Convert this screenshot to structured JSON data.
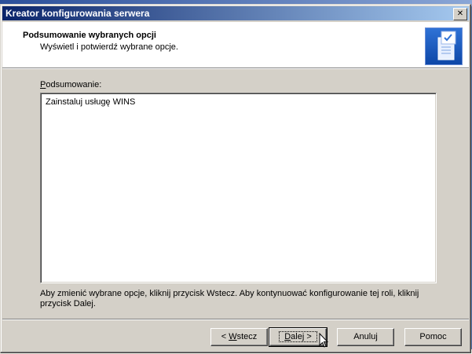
{
  "window": {
    "title": "Kreator konfigurowania serwera",
    "close_glyph": "✕"
  },
  "header": {
    "title": "Podsumowanie wybranych opcji",
    "subtitle": "Wyświetl i potwierdź wybrane opcje.",
    "icon": "server-wizard-icon"
  },
  "summary": {
    "label_accesskey": "P",
    "label_rest": "odsumowanie:",
    "text": "Zainstaluj usługę WINS"
  },
  "instruction": "Aby zmienić wybrane opcje, kliknij przycisk Wstecz. Aby kontynuować konfigurowanie tej roli, kliknij przycisk Dalej.",
  "buttons": {
    "back_prefix": "< ",
    "back_accesskey": "W",
    "back_rest": "stecz",
    "next_accesskey": "D",
    "next_rest": "alej >",
    "cancel": "Anuluj",
    "help": "Pomoc"
  }
}
